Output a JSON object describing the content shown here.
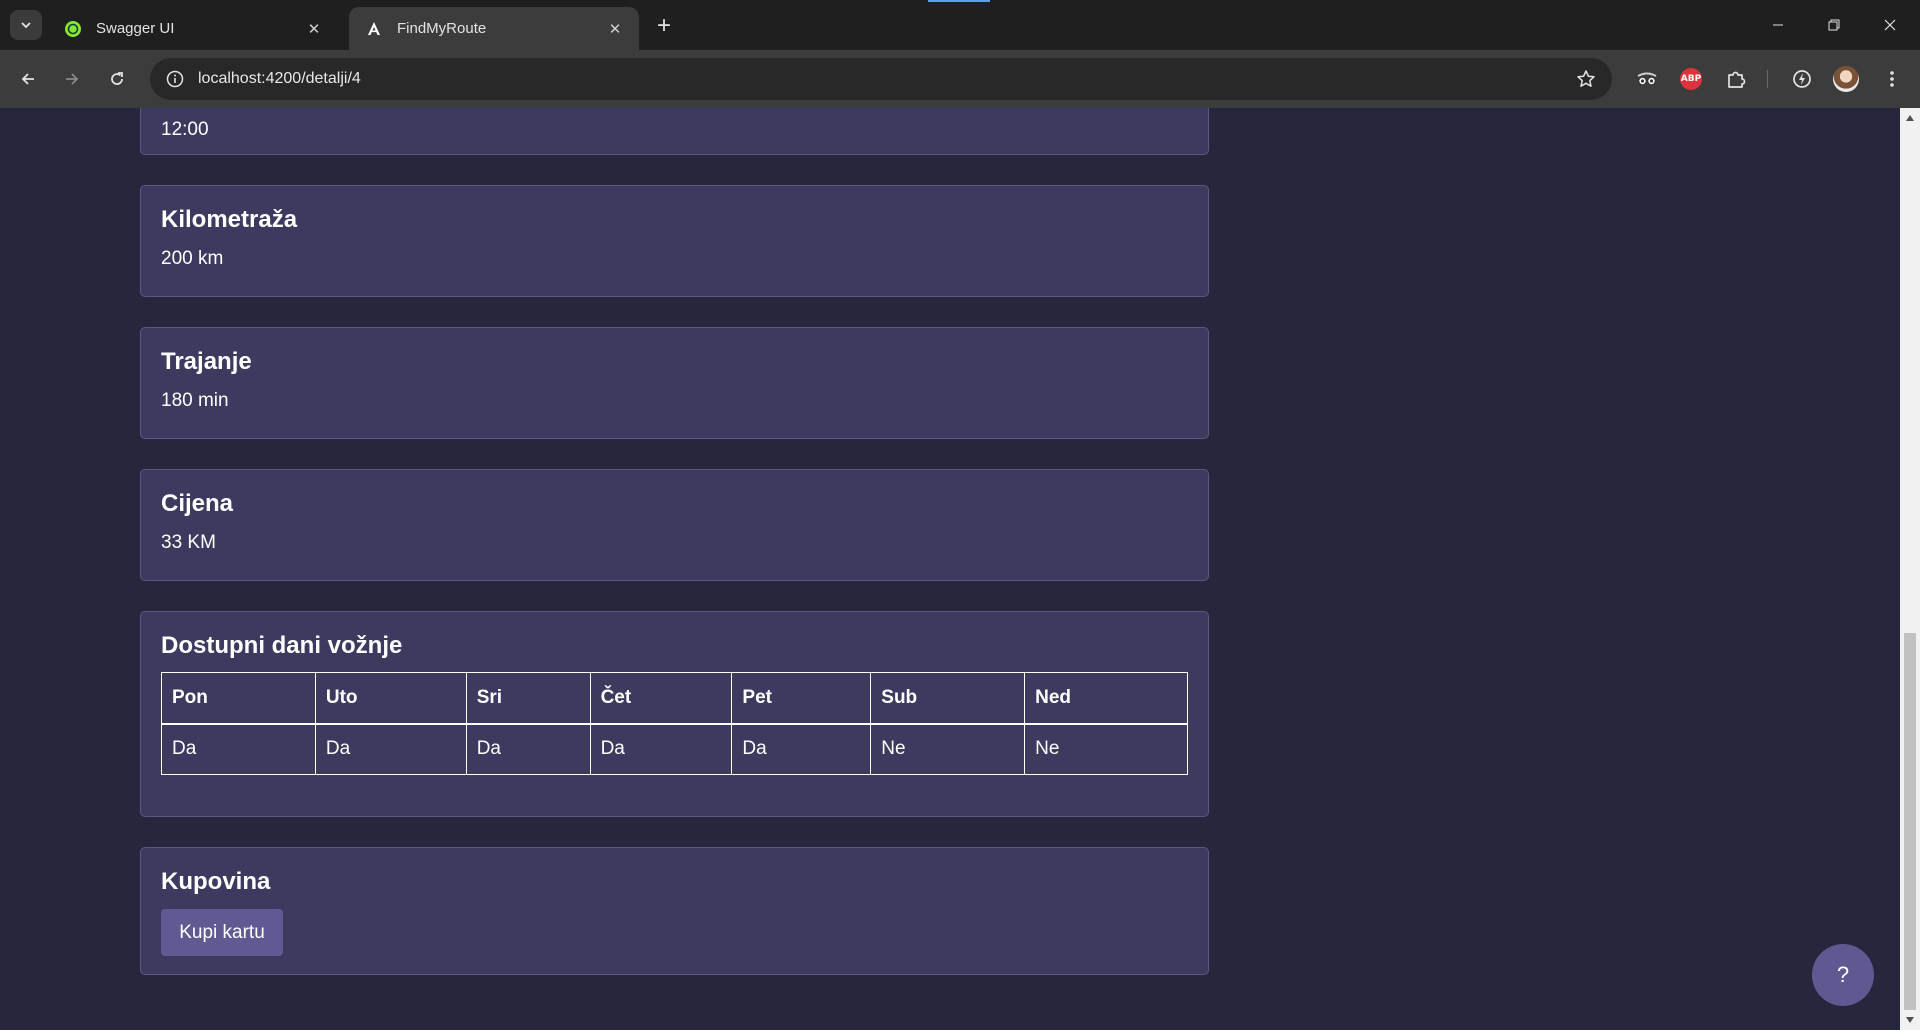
{
  "browser": {
    "tabs": [
      {
        "title": "Swagger UI",
        "active": false
      },
      {
        "title": "FindMyRoute",
        "active": true
      }
    ],
    "url": "localhost:4200/detalji/4"
  },
  "details": {
    "time_value": "12:00",
    "distance": {
      "title": "Kilometraža",
      "value": "200 km"
    },
    "duration": {
      "title": "Trajanje",
      "value": "180 min"
    },
    "price": {
      "title": "Cijena",
      "value": "33 KM"
    },
    "days": {
      "title": "Dostupni dani vožnje",
      "headers": [
        "Pon",
        "Uto",
        "Sri",
        "Čet",
        "Pet",
        "Sub",
        "Ned"
      ],
      "values": [
        "Da",
        "Da",
        "Da",
        "Da",
        "Da",
        "Ne",
        "Ne"
      ]
    },
    "purchase": {
      "title": "Kupovina",
      "button_label": "Kupi kartu"
    }
  },
  "help_button_label": "?",
  "colors": {
    "page_background": "#26263d",
    "card_background": "#3c3a5e",
    "button_background": "#5f5b92"
  }
}
